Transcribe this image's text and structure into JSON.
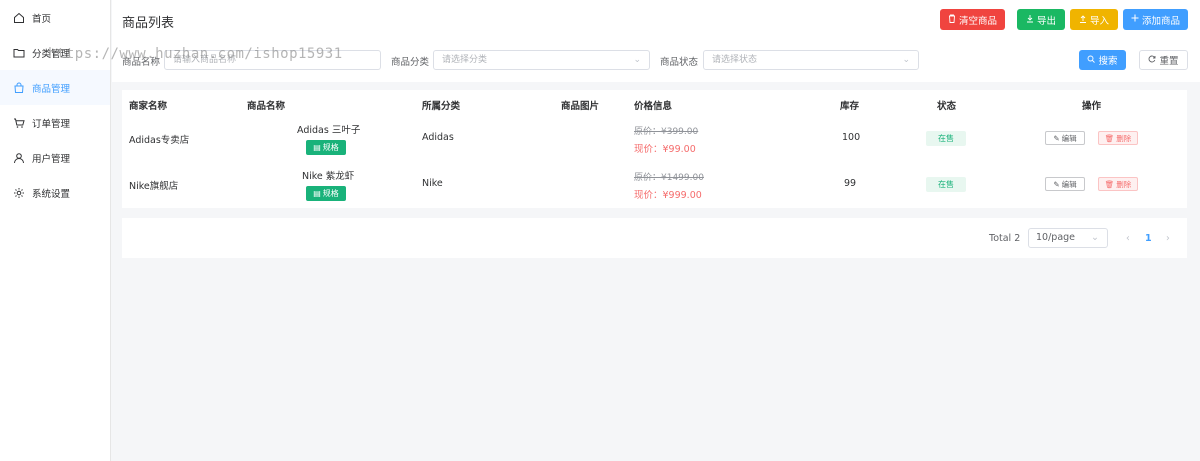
{
  "sidebar": {
    "items": [
      {
        "label": "首页",
        "icon": "home-icon"
      },
      {
        "label": "分类管理",
        "icon": "folder-icon"
      },
      {
        "label": "商品管理",
        "icon": "bag-icon",
        "active": true
      },
      {
        "label": "订单管理",
        "icon": "cart-icon"
      },
      {
        "label": "用户管理",
        "icon": "user-icon"
      },
      {
        "label": "系统设置",
        "icon": "gear-icon"
      }
    ]
  },
  "header": {
    "title": "商品列表",
    "buttons": {
      "clear": "清空商品",
      "export": "导出",
      "import": "导入",
      "add": "添加商品"
    }
  },
  "filters": {
    "name_label": "商品名称",
    "name_placeholder": "请输入商品名称",
    "category_label": "商品分类",
    "category_placeholder": "请选择分类",
    "status_label": "商品状态",
    "status_placeholder": "请选择状态",
    "search": "搜索",
    "reset": "重置"
  },
  "table": {
    "columns": [
      "商家名称",
      "商品名称",
      "所属分类",
      "商品图片",
      "价格信息",
      "库存",
      "状态",
      "操作"
    ],
    "rows": [
      {
        "merchant": "Adidas专卖店",
        "name": "Adidas 三叶子",
        "spec": "规格",
        "category": "Adidas",
        "old_price": "原价：¥399.00",
        "new_price": "现价：¥99.00",
        "stock": "100",
        "status": "在售",
        "edit": "编辑",
        "delete": "删除"
      },
      {
        "merchant": "Nike旗舰店",
        "name": "Nike 紫龙虾",
        "spec": "规格",
        "category": "Nike",
        "old_price": "原价：¥1499.00",
        "new_price": "现价：¥999.00",
        "stock": "99",
        "status": "在售",
        "edit": "编辑",
        "delete": "删除"
      }
    ]
  },
  "pagination": {
    "total": "Total 2",
    "page_size": "10/page",
    "current": "1",
    "prev": "‹",
    "next": "›"
  },
  "watermark": "https://www.huzhan.com/ishop15931",
  "colors": {
    "primary": "#409eff",
    "danger": "#f0443f",
    "success": "#1ab863",
    "warning": "#f0b400",
    "tag_green": "#19b27a"
  }
}
